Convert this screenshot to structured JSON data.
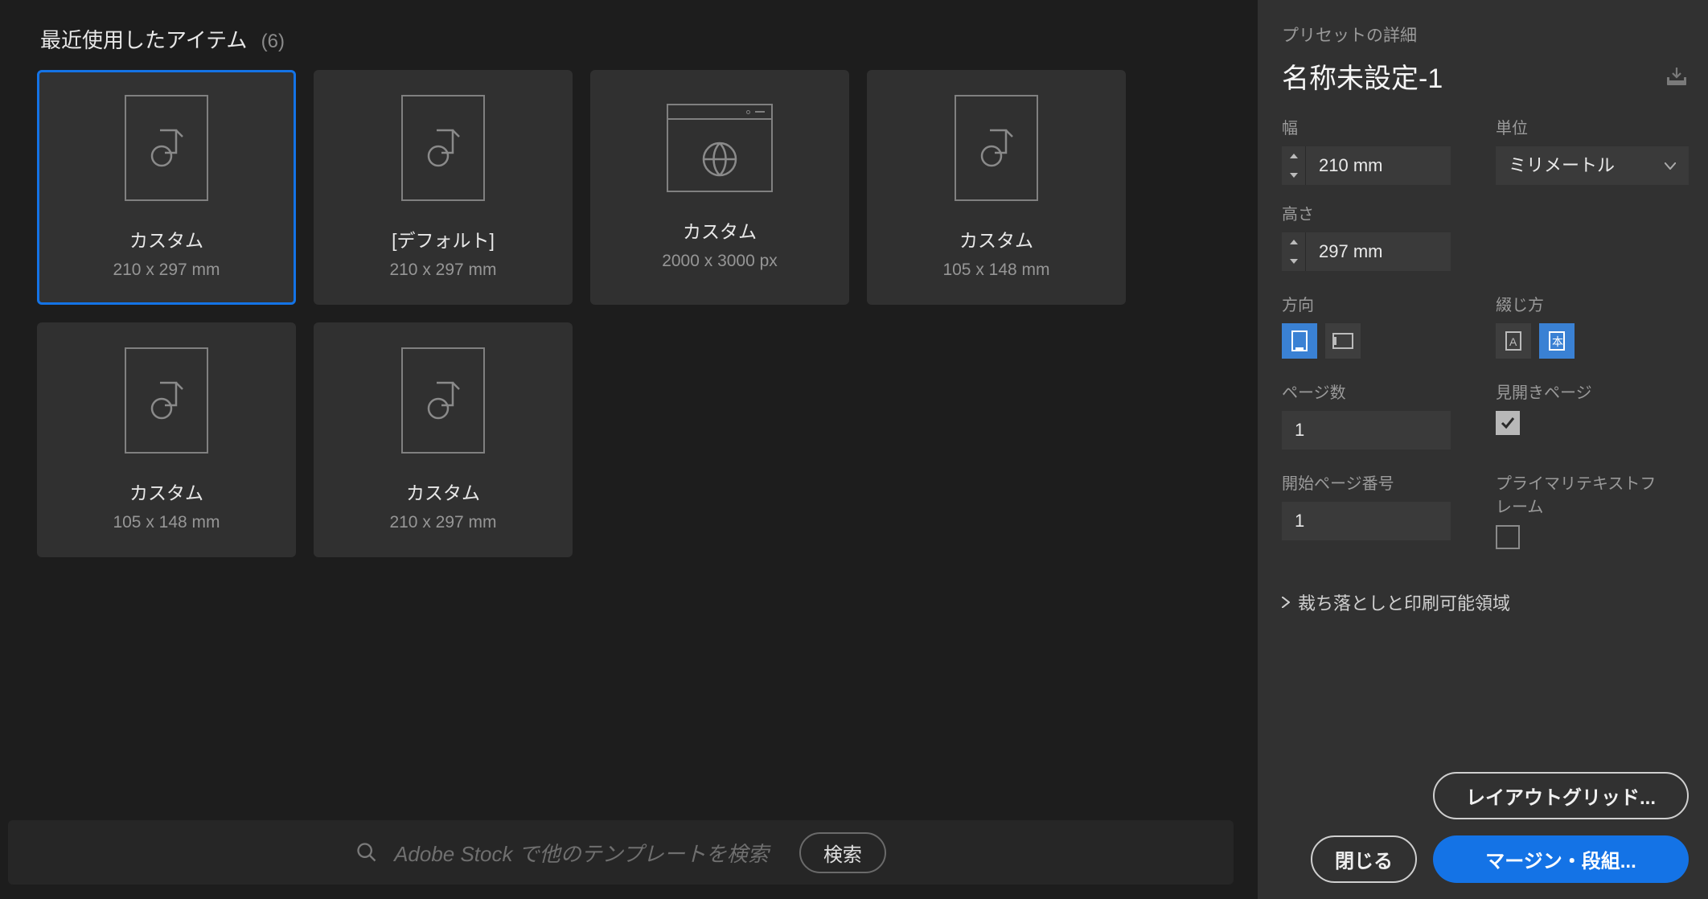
{
  "main": {
    "section_title": "最近使用したアイテム",
    "count_display": "(6)",
    "cards": [
      {
        "label": "カスタム",
        "sub": "210 x 297 mm",
        "icon": "doc",
        "selected": true
      },
      {
        "label": "[デフォルト]",
        "sub": "210 x 297 mm",
        "icon": "doc",
        "selected": false
      },
      {
        "label": "カスタム",
        "sub": "2000 x 3000 px",
        "icon": "web",
        "selected": false
      },
      {
        "label": "カスタム",
        "sub": "105 x 148 mm",
        "icon": "doc",
        "selected": false
      },
      {
        "label": "カスタム",
        "sub": "105 x 148 mm",
        "icon": "doc",
        "selected": false
      },
      {
        "label": "カスタム",
        "sub": "210 x 297 mm",
        "icon": "doc",
        "selected": false
      }
    ],
    "footer": {
      "placeholder": "Adobe Stock で他のテンプレートを検索",
      "go_label": "検索"
    }
  },
  "panel": {
    "header": "プリセットの詳細",
    "name": "名称未設定-1",
    "width": {
      "label": "幅",
      "value": "210 mm"
    },
    "height": {
      "label": "高さ",
      "value": "297 mm"
    },
    "units": {
      "label": "単位",
      "value": "ミリメートル"
    },
    "orientation": {
      "label": "方向",
      "selected": "portrait"
    },
    "binding": {
      "label": "綴じ方",
      "selected": "rtl"
    },
    "pages": {
      "label": "ページ数",
      "value": "1"
    },
    "facing": {
      "label": "見開きページ",
      "checked": true
    },
    "start_page": {
      "label": "開始ページ番号",
      "value": "1"
    },
    "primary_tf": {
      "label": "プライマリテキストフレーム",
      "checked": false
    },
    "bleed_section": "裁ち落としと印刷可能領域",
    "buttons": {
      "layout_grid": "レイアウトグリッド...",
      "close": "閉じる",
      "margins": "マージン・段組..."
    }
  }
}
